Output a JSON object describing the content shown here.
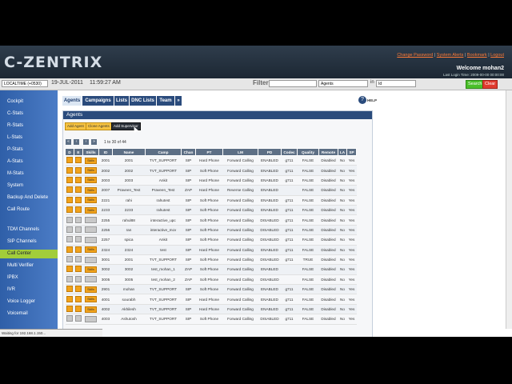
{
  "header": {
    "logo": "C-ZENTRIX",
    "links": [
      "Change Password",
      "System Alerts",
      "Bookmark",
      "Logout"
    ],
    "welcome": "Welcome mohan2",
    "last_login": "Last Login Time: 2009-00-00 00:00:00"
  },
  "timebar": {
    "timezone": "LOCALTIME (+0530)",
    "date": "19-JUL-2011",
    "time": "11:59:27 AM",
    "filter_label": "Filter",
    "filter_select": "Agents",
    "in_label": "in",
    "in_select": "Id",
    "search_label": "Search",
    "clear_label": "Clear"
  },
  "sidebar": {
    "items": [
      "Cockpit",
      "C-Stats",
      "R-Stats",
      "L-Stats",
      "P-Stats",
      "A-Stats",
      "M-Stats",
      "System",
      "Backup And Delete",
      "Call Route",
      "TDM Channels",
      "SIP Channels",
      "Call Center",
      "Multi Verifier",
      "IPBX",
      "IVR",
      "Voice Logger",
      "Voicemail"
    ],
    "active": "Call Center"
  },
  "tabs": [
    "Agents",
    "Campaigns",
    "Lists",
    "DNC Lists",
    "Team",
    "»"
  ],
  "help_label": "HELP",
  "panel_title": "Agents",
  "actions": {
    "add_agent": "Add Agent",
    "clone_agents": "Clone Agents",
    "add_supervisor": "Add Supervisor"
  },
  "pager_text": "1 to 30 of 44",
  "table": {
    "headers": [
      "D",
      "E",
      "Skills",
      "ID",
      "Name",
      "Camp",
      "Chan",
      "PT",
      "LM",
      "PD",
      "Codec",
      "Quality",
      "Remote",
      "LA",
      "SP"
    ],
    "skills_label": "Skills",
    "rows": [
      {
        "id": "2001",
        "name": "2001",
        "camp": "TVT_SUPPORT",
        "chan": "SIP",
        "pt": "Hard Phone",
        "lm": "Forward Calling",
        "pd": "ENABLED",
        "codec": "g711",
        "quality": "FALSE",
        "remote": "Disabled",
        "la": "No",
        "sp": "Yes",
        "enabled": true
      },
      {
        "id": "2002",
        "name": "2002",
        "camp": "TVT_SUPPORT",
        "chan": "SIP",
        "pt": "Soft Phone",
        "lm": "Forward Calling",
        "pd": "ENABLED",
        "codec": "g711",
        "quality": "FALSE",
        "remote": "Disabled",
        "la": "No",
        "sp": "Yes",
        "enabled": true
      },
      {
        "id": "2003",
        "name": "2003",
        "camp": "Ankit",
        "chan": "SIP",
        "pt": "Hard Phone",
        "lm": "Forward Calling",
        "pd": "ENABLED",
        "codec": "g711",
        "quality": "FALSE",
        "remote": "Disabled",
        "la": "No",
        "sp": "Yes",
        "enabled": true
      },
      {
        "id": "2007",
        "name": "Praveen_Test",
        "camp": "Praveen_Test",
        "chan": "ZAP",
        "pt": "Hard Phone",
        "lm": "Reverse Calling",
        "pd": "ENABLED",
        "codec": "",
        "quality": "FALSE",
        "remote": "Disabled",
        "la": "No",
        "sp": "Yes",
        "enabled": true
      },
      {
        "id": "2221",
        "name": "rahi",
        "camp": "rahutest",
        "chan": "SIP",
        "pt": "Soft Phone",
        "lm": "Forward Calling",
        "pd": "ENABLED",
        "codec": "g711",
        "quality": "FALSE",
        "remote": "Disabled",
        "la": "No",
        "sp": "Yes",
        "enabled": true
      },
      {
        "id": "2233",
        "name": "2233",
        "camp": "rahutest",
        "chan": "SIP",
        "pt": "Soft Phone",
        "lm": "Forward Calling",
        "pd": "ENABLED",
        "codec": "g711",
        "quality": "FALSE",
        "remote": "Disabled",
        "la": "No",
        "sp": "Yes",
        "enabled": true
      },
      {
        "id": "2255",
        "name": "rahul88",
        "camp": "interactive_upc",
        "chan": "SIP",
        "pt": "Soft Phone",
        "lm": "Forward Calling",
        "pd": "DISABLED",
        "codec": "g711",
        "quality": "FALSE",
        "remote": "Disabled",
        "la": "No",
        "sp": "Yes",
        "enabled": false
      },
      {
        "id": "2256",
        "name": "ran",
        "camp": "interactive_mcv",
        "chan": "SIP",
        "pt": "Soft Phone",
        "lm": "Forward Calling",
        "pd": "DISABLED",
        "codec": "g711",
        "quality": "FALSE",
        "remote": "Disabled",
        "la": "No",
        "sp": "Yes",
        "enabled": false
      },
      {
        "id": "2257",
        "name": "spica",
        "camp": "Ankit",
        "chan": "SIP",
        "pt": "Soft Phone",
        "lm": "Forward Calling",
        "pd": "DISABLED",
        "codec": "g711",
        "quality": "FALSE",
        "remote": "Disabled",
        "la": "No",
        "sp": "Yes",
        "enabled": false
      },
      {
        "id": "2324",
        "name": "2324",
        "camp": "test",
        "chan": "SIP",
        "pt": "Hard Phone",
        "lm": "Forward Calling",
        "pd": "ENABLED",
        "codec": "g711",
        "quality": "FALSE",
        "remote": "Disabled",
        "la": "No",
        "sp": "Yes",
        "enabled": true
      },
      {
        "id": "3001",
        "name": "2001",
        "camp": "TVT_SUPPORT",
        "chan": "SIP",
        "pt": "Soft Phone",
        "lm": "Forward Calling",
        "pd": "DISABLED",
        "codec": "g711",
        "quality": "TRUE",
        "remote": "Disabled",
        "la": "No",
        "sp": "Yes",
        "enabled": false
      },
      {
        "id": "3002",
        "name": "3002",
        "camp": "test_mohan_1",
        "chan": "ZAP",
        "pt": "Soft Phone",
        "lm": "Forward Calling",
        "pd": "ENABLED",
        "codec": "",
        "quality": "FALSE",
        "remote": "Disabled",
        "la": "No",
        "sp": "Yes",
        "enabled": true
      },
      {
        "id": "3005",
        "name": "3005",
        "camp": "test_mohan_2",
        "chan": "ZAP",
        "pt": "Soft Phone",
        "lm": "Forward Calling",
        "pd": "DISABLED",
        "codec": "",
        "quality": "FALSE",
        "remote": "Disabled",
        "la": "No",
        "sp": "Yes",
        "enabled": false
      },
      {
        "id": "2901",
        "name": "mohan",
        "camp": "TVT_SUPPORT",
        "chan": "SIP",
        "pt": "Soft Phone",
        "lm": "Forward Calling",
        "pd": "ENABLED",
        "codec": "g711",
        "quality": "FALSE",
        "remote": "Disabled",
        "la": "No",
        "sp": "Yes",
        "enabled": true
      },
      {
        "id": "4001",
        "name": "sourabh",
        "camp": "TVT_SUPPORT",
        "chan": "SIP",
        "pt": "Hard Phone",
        "lm": "Forward Calling",
        "pd": "ENABLED",
        "codec": "g711",
        "quality": "FALSE",
        "remote": "Disabled",
        "la": "No",
        "sp": "Yes",
        "enabled": true
      },
      {
        "id": "4002",
        "name": "Akhilesh",
        "camp": "TVT_SUPPORT",
        "chan": "SIP",
        "pt": "Hard Phone",
        "lm": "Forward Calling",
        "pd": "ENABLED",
        "codec": "g711",
        "quality": "FALSE",
        "remote": "Disabled",
        "la": "No",
        "sp": "Yes",
        "enabled": true
      },
      {
        "id": "4003",
        "name": "Ashutosh",
        "camp": "TVT_SUPPORT",
        "chan": "SIP",
        "pt": "Soft Phone",
        "lm": "Forward Calling",
        "pd": "DISABLED",
        "codec": "g711",
        "quality": "FALSE",
        "remote": "Disabled",
        "la": "No",
        "sp": "Yes",
        "enabled": false
      }
    ]
  },
  "status_text": "Waiting for 192.168.1.150..."
}
